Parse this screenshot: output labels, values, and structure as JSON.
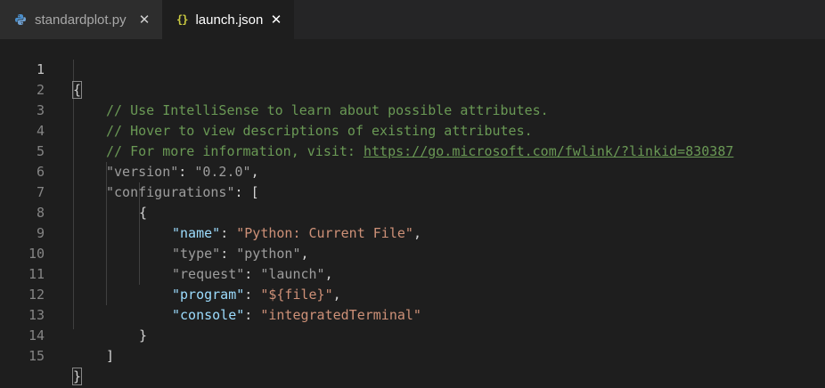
{
  "tabs": [
    {
      "label": "standardplot.py",
      "icon": "python-file-icon",
      "close": "✕",
      "active": false
    },
    {
      "label": "launch.json",
      "icon_text": "{}",
      "icon": "json-file-icon",
      "close": "✕",
      "active": true
    }
  ],
  "editor": {
    "line_numbers": [
      "1",
      "2",
      "3",
      "4",
      "5",
      "6",
      "7",
      "8",
      "9",
      "10",
      "11",
      "12",
      "13",
      "14",
      "15"
    ],
    "active_line": "1",
    "lines": {
      "l1": {
        "brace": "{"
      },
      "l2": {
        "comment": "// Use IntelliSense to learn about possible attributes."
      },
      "l3": {
        "comment": "// Hover to view descriptions of existing attributes."
      },
      "l4": {
        "comment": "// For more information, visit: ",
        "link": "https://go.microsoft.com/fwlink/?linkid=830387"
      },
      "l5": {
        "key": "\"version\"",
        "sep": ": ",
        "value": "\"0.2.0\"",
        "end": ","
      },
      "l6": {
        "key": "\"configurations\"",
        "sep": ": ",
        "value": "["
      },
      "l7": {
        "brace": "{"
      },
      "l8": {
        "key": "\"name\"",
        "sep": ": ",
        "value": "\"Python: Current File\"",
        "end": ","
      },
      "l9": {
        "key": "\"type\"",
        "sep": ": ",
        "value": "\"python\"",
        "end": ","
      },
      "l10": {
        "key": "\"request\"",
        "sep": ": ",
        "value": "\"launch\"",
        "end": ","
      },
      "l11": {
        "key": "\"program\"",
        "sep": ": ",
        "value": "\"${file}\"",
        "end": ","
      },
      "l12": {
        "key": "\"console\"",
        "sep": ": ",
        "value": "\"integratedTerminal\""
      },
      "l13": {
        "brace": "}"
      },
      "l14": {
        "brace": "]"
      },
      "l15": {
        "brace": "}"
      }
    }
  },
  "colors": {
    "background": "#1e1e1e",
    "tabbar": "#252526",
    "comment": "#6a9955",
    "key": "#9cdcfe",
    "string": "#ce9178",
    "json_icon": "#cbcb41",
    "python_icon": "#4a8dc9"
  }
}
